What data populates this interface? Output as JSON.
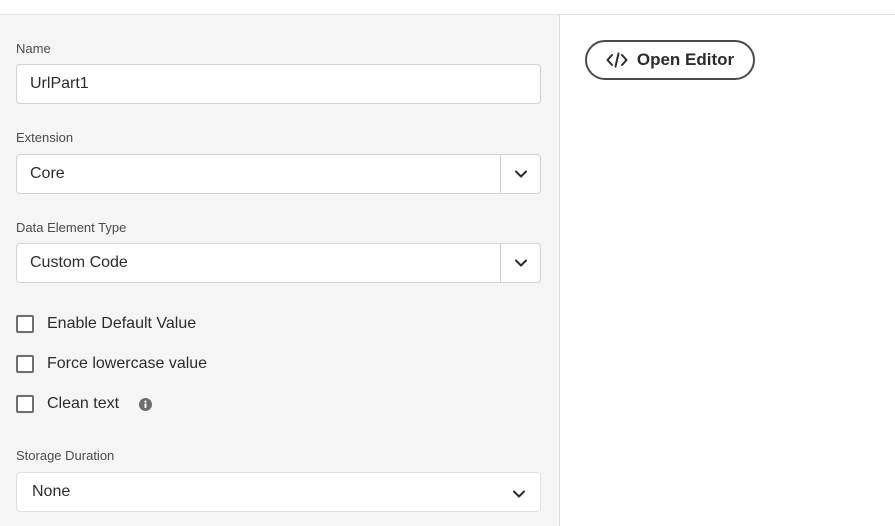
{
  "form": {
    "name_label": "Name",
    "name_value": "UrlPart1",
    "extension_label": "Extension",
    "extension_value": "Core",
    "type_label": "Data Element Type",
    "type_value": "Custom Code",
    "checkboxes": [
      {
        "label": "Enable Default Value",
        "checked": false
      },
      {
        "label": "Force lowercase value",
        "checked": false
      },
      {
        "label": "Clean text",
        "checked": false
      }
    ],
    "storage_label": "Storage Duration",
    "storage_value": "None"
  },
  "editor": {
    "open_label": "Open Editor"
  },
  "icons": {
    "dropdown": "chevron-down-icon",
    "info": "info-icon",
    "code": "code-icon"
  },
  "colors": {
    "panel_bg": "#f5f5f5",
    "border": "#d2d2d2",
    "text": "#2c2c2c"
  }
}
